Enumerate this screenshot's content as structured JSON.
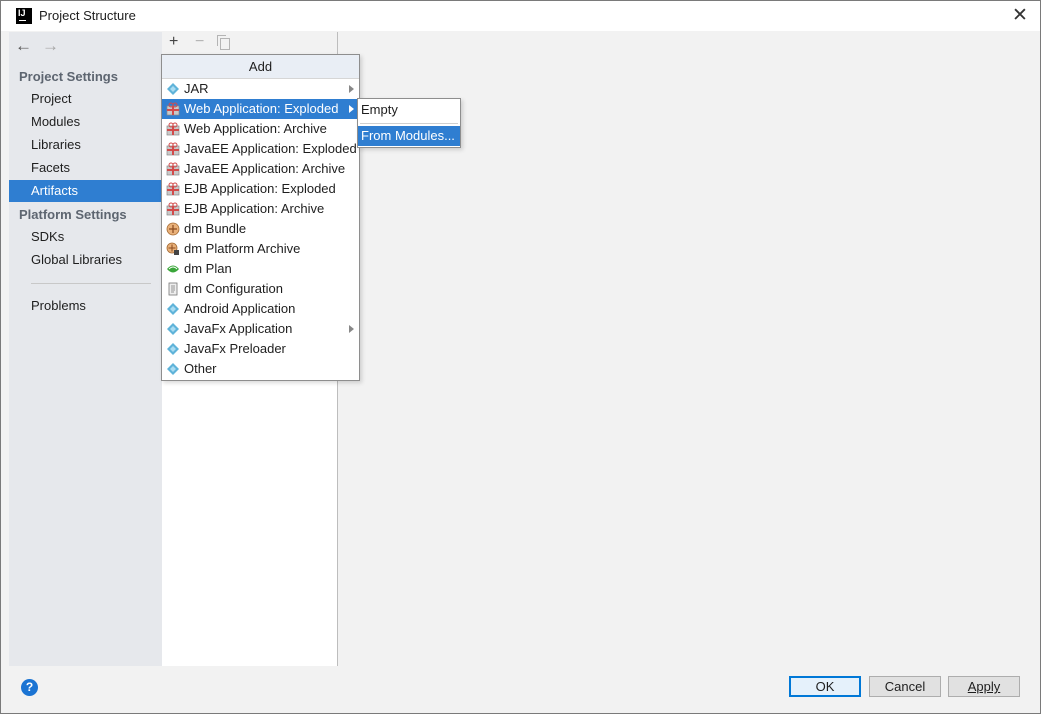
{
  "window": {
    "title": "Project Structure",
    "app_icon": "IJ"
  },
  "nav": {
    "back_icon": "←",
    "forward_icon": "→"
  },
  "sidebar": {
    "project_settings_label": "Project Settings",
    "project_items": [
      "Project",
      "Modules",
      "Libraries",
      "Facets",
      "Artifacts"
    ],
    "selected_item": "Artifacts",
    "platform_settings_label": "Platform Settings",
    "platform_items": [
      "SDKs",
      "Global Libraries"
    ],
    "problems_label": "Problems"
  },
  "toolbar": {
    "add_icon": "+",
    "remove_icon": "−"
  },
  "add_popup": {
    "header": "Add",
    "items": [
      {
        "label": "JAR",
        "icon": "diamond-icon",
        "submenu": true
      },
      {
        "label": "Web Application: Exploded",
        "icon": "gift-icon",
        "submenu": true,
        "highlighted": true
      },
      {
        "label": "Web Application: Archive",
        "icon": "gift-icon"
      },
      {
        "label": "JavaEE Application: Exploded",
        "icon": "gift-icon"
      },
      {
        "label": "JavaEE Application: Archive",
        "icon": "gift-icon"
      },
      {
        "label": "EJB Application: Exploded",
        "icon": "gift-icon"
      },
      {
        "label": "EJB Application: Archive",
        "icon": "gift-icon"
      },
      {
        "label": "dm Bundle",
        "icon": "bundle-icon"
      },
      {
        "label": "dm Platform Archive",
        "icon": "bundle-lock-icon"
      },
      {
        "label": "dm Plan",
        "icon": "leaf-icon"
      },
      {
        "label": "dm Configuration",
        "icon": "document-icon"
      },
      {
        "label": "Android Application",
        "icon": "diamond-icon"
      },
      {
        "label": "JavaFx Application",
        "icon": "diamond-icon",
        "submenu": true
      },
      {
        "label": "JavaFx Preloader",
        "icon": "diamond-icon"
      },
      {
        "label": "Other",
        "icon": "diamond-icon"
      }
    ]
  },
  "submenu": {
    "items": [
      "Empty",
      "From Modules..."
    ],
    "highlighted_index": 1
  },
  "footer": {
    "help_icon": "?",
    "ok_label": "OK",
    "cancel_label": "Cancel",
    "apply_label": "Apply"
  },
  "colors": {
    "selection": "#2f7ed1",
    "sidebar_bg": "#e6e8ec",
    "dialog_bg": "#f2f2f2"
  }
}
